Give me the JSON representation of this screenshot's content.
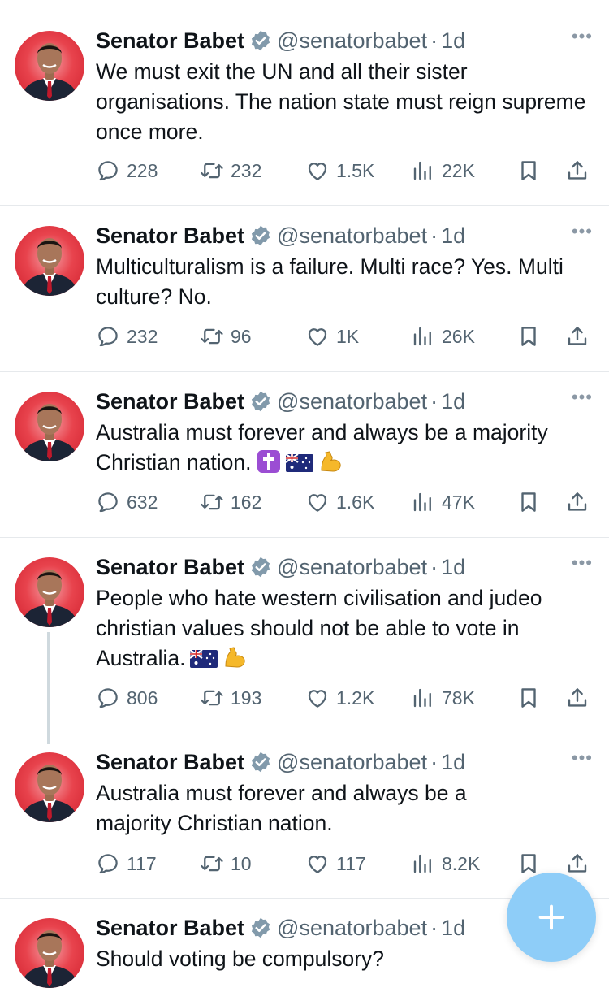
{
  "tweets": [
    {
      "name": "Senator Babet",
      "handle": "@senatorbabet",
      "dot": "·",
      "time": "1d",
      "text": "We must exit the UN and all their sister organisations. The nation state must reign supreme once more.",
      "replies": "228",
      "retweets": "232",
      "likes": "1.5K",
      "views": "22K"
    },
    {
      "name": "Senator Babet",
      "handle": "@senatorbabet",
      "dot": "·",
      "time": "1d",
      "text": "Multiculturalism is a failure. Multi race? Yes. Multi culture? No.",
      "replies": "232",
      "retweets": "96",
      "likes": "1K",
      "views": "26K"
    },
    {
      "name": "Senator Babet",
      "handle": "@senatorbabet",
      "dot": "·",
      "time": "1d",
      "text": "Australia must forever and always be a majority Christian nation.",
      "emojis": [
        "latin-cross-emoji",
        "australia-flag-emoji",
        "flexed-biceps-emoji"
      ],
      "replies": "632",
      "retweets": "162",
      "likes": "1.6K",
      "views": "47K"
    },
    {
      "name": "Senator Babet",
      "handle": "@senatorbabet",
      "dot": "·",
      "time": "1d",
      "text": "People who hate western civilisation and judeo christian values should not be able to vote in Australia.",
      "emojis": [
        "australia-flag-emoji",
        "flexed-biceps-emoji"
      ],
      "replies": "806",
      "retweets": "193",
      "likes": "1.2K",
      "views": "78K"
    },
    {
      "name": "Senator Babet",
      "handle": "@senatorbabet",
      "dot": "·",
      "time": "1d",
      "text": "Australia must forever and always be a majority Christian nation.",
      "replies": "117",
      "retweets": "10",
      "likes": "117",
      "views": "8.2K"
    },
    {
      "name": "Senator Babet",
      "handle": "@senatorbabet",
      "dot": "·",
      "time": "1d",
      "text": "Should voting be compulsory?"
    }
  ],
  "colors": {
    "text": "#0f1419",
    "secondary": "#536471",
    "verified_badge": "#829aab",
    "avatar_background": "#e8434d",
    "fab": "#8ecdf8",
    "divider": "#e6e9ec"
  },
  "icons": [
    "reply-icon",
    "retweet-icon",
    "like-icon",
    "views-icon",
    "bookmark-icon",
    "share-icon",
    "more-icon",
    "verified-badge-icon",
    "compose-icon"
  ]
}
